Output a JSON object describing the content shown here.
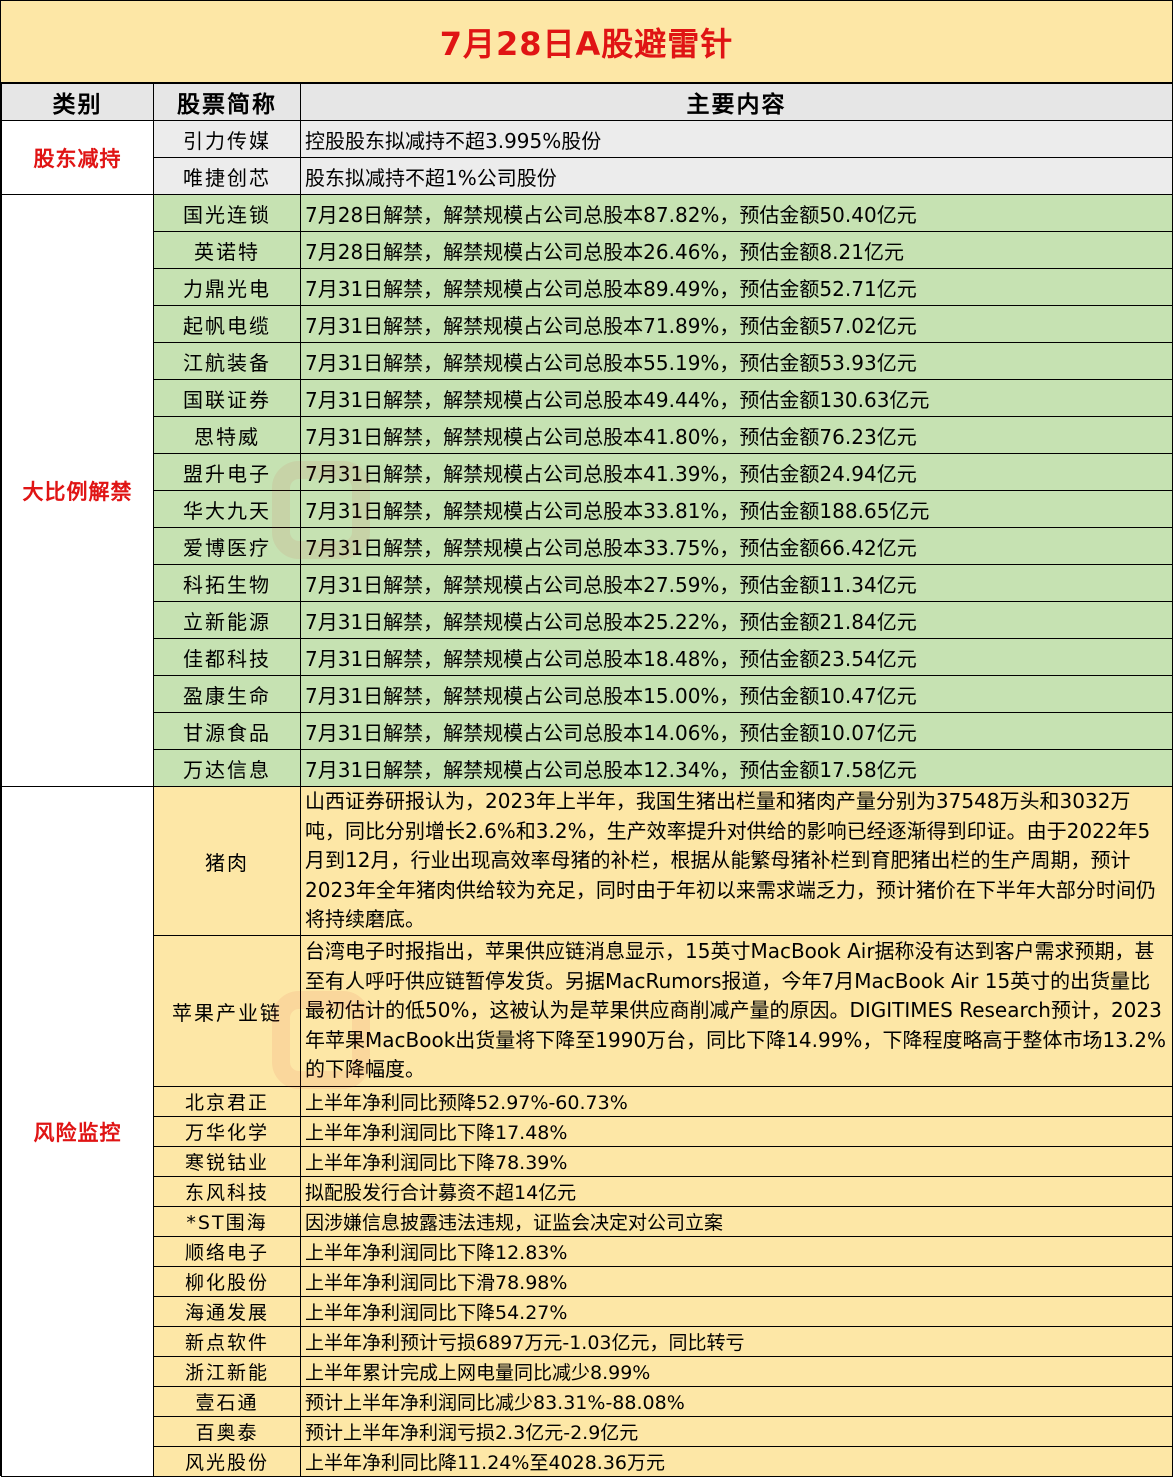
{
  "title": "7月28日A股避雷针",
  "headers": {
    "category": "类别",
    "stock": "股票简称",
    "content": "主要内容"
  },
  "groups": [
    {
      "category": "股东减持",
      "rows": [
        {
          "name": "引力传媒",
          "content": "控股股东拟减持不超3.995%股份"
        },
        {
          "name": "唯捷创芯",
          "content": "股东拟减持不超1%公司股份"
        }
      ]
    },
    {
      "category": "大比例解禁",
      "rows": [
        {
          "name": "国光连锁",
          "content": "7月28日解禁，解禁规模占公司总股本87.82%，预估金额50.40亿元"
        },
        {
          "name": "英诺特",
          "content": "7月28日解禁，解禁规模占公司总股本26.46%，预估金额8.21亿元"
        },
        {
          "name": "力鼎光电",
          "content": "7月31日解禁，解禁规模占公司总股本89.49%，预估金额52.71亿元"
        },
        {
          "name": "起帆电缆",
          "content": "7月31日解禁，解禁规模占公司总股本71.89%，预估金额57.02亿元"
        },
        {
          "name": "江航装备",
          "content": "7月31日解禁，解禁规模占公司总股本55.19%，预估金额53.93亿元"
        },
        {
          "name": "国联证券",
          "content": "7月31日解禁，解禁规模占公司总股本49.44%，预估金额130.63亿元"
        },
        {
          "name": "思特威",
          "content": "7月31日解禁，解禁规模占公司总股本41.80%，预估金额76.23亿元"
        },
        {
          "name": "盟升电子",
          "content": "7月31日解禁，解禁规模占公司总股本41.39%，预估金额24.94亿元"
        },
        {
          "name": "华大九天",
          "content": "7月31日解禁，解禁规模占公司总股本33.81%，预估金额188.65亿元"
        },
        {
          "name": "爱博医疗",
          "content": "7月31日解禁，解禁规模占公司总股本33.75%，预估金额66.42亿元"
        },
        {
          "name": "科拓生物",
          "content": "7月31日解禁，解禁规模占公司总股本27.59%，预估金额11.34亿元"
        },
        {
          "name": "立新能源",
          "content": "7月31日解禁，解禁规模占公司总股本25.22%，预估金额21.84亿元"
        },
        {
          "name": "佳都科技",
          "content": "7月31日解禁，解禁规模占公司总股本18.48%，预估金额23.54亿元"
        },
        {
          "name": "盈康生命",
          "content": "7月31日解禁，解禁规模占公司总股本15.00%，预估金额10.47亿元"
        },
        {
          "name": "甘源食品",
          "content": "7月31日解禁，解禁规模占公司总股本14.06%，预估金额10.07亿元"
        },
        {
          "name": "万达信息",
          "content": "7月31日解禁，解禁规模占公司总股本12.34%，预估金额17.58亿元"
        }
      ]
    },
    {
      "category": "风险监控",
      "rows": [
        {
          "name": "猪肉",
          "content": "山西证券研报认为，2023年上半年，我国生猪出栏量和猪肉产量分别为37548万头和3032万吨，同比分别增长2.6%和3.2%，生产效率提升对供给的影响已经逐渐得到印证。由于2022年5月到12月，行业出现高效率母猪的补栏，根据从能繁母猪补栏到育肥猪出栏的生产周期，预计2023年全年猪肉供给较为充足，同时由于年初以来需求端乏力，预计猪价在下半年大部分时间仍将持续磨底。"
        },
        {
          "name": "苹果产业链",
          "content": "台湾电子时报指出，苹果供应链消息显示，15英寸MacBook Air据称没有达到客户需求预期，甚至有人呼吁供应链暂停发货。另据MacRumors报道，今年7月MacBook Air 15英寸的出货量比最初估计的低50%，这被认为是苹果供应商削减产量的原因。DIGITIMES Research预计，2023年苹果MacBook出货量将下降至1990万台，同比下降14.99%，下降程度略高于整体市场13.2%的下降幅度。"
        },
        {
          "name": "北京君正",
          "content": "上半年净利同比预降52.97%-60.73%"
        },
        {
          "name": "万华化学",
          "content": "上半年净利润同比下降17.48%"
        },
        {
          "name": "寒锐钴业",
          "content": "上半年净利润同比下降78.39%"
        },
        {
          "name": "东风科技",
          "content": "拟配股发行合计募资不超14亿元"
        },
        {
          "name": "*ST围海",
          "content": "因涉嫌信息披露违法违规，证监会决定对公司立案"
        },
        {
          "name": "顺络电子",
          "content": "上半年净利润同比下降12.83%"
        },
        {
          "name": "柳化股份",
          "content": "上半年净利润同比下滑78.98%"
        },
        {
          "name": "海通发展",
          "content": "上半年净利润同比下降54.27%"
        },
        {
          "name": "新点软件",
          "content": "上半年净利预计亏损6897万元-1.03亿元，同比转亏"
        },
        {
          "name": "浙江新能",
          "content": "上半年累计完成上网电量同比减少8.99%"
        },
        {
          "name": "壹石通",
          "content": "预计上半年净利润同比减少83.31%-88.08%"
        },
        {
          "name": "百奥泰",
          "content": "预计上半年净利润亏损2.3亿元-2.9亿元"
        },
        {
          "name": "风光股份",
          "content": "上半年净利同比降11.24%至4028.36万元"
        }
      ]
    }
  ],
  "colors": {
    "title_bg": "#fde7a6",
    "title_text": "#e01414",
    "header_bg": "#e6e6e6",
    "gray_rows": "#ececec",
    "green_rows": "#c6e2b2",
    "yellow_rows": "#fde7a6",
    "category_text": "#e01414"
  }
}
